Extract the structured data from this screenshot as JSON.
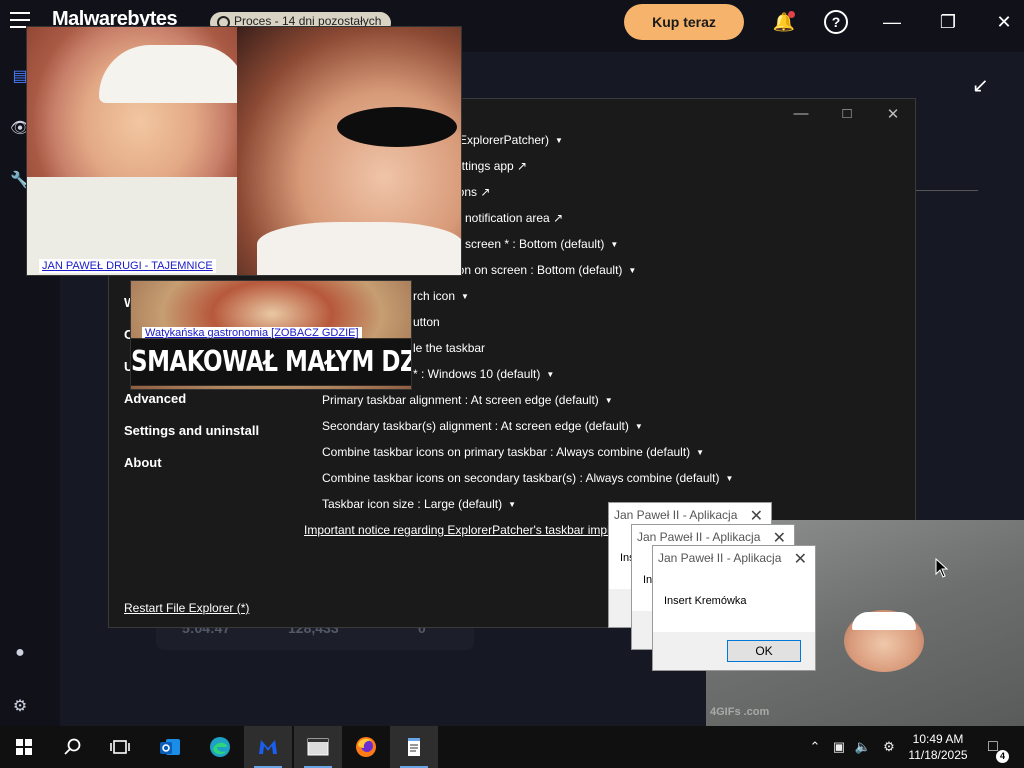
{
  "malwarebytes": {
    "logo": "Malwarebytes",
    "trial_badge": "Proces - 14 dni pozostałych",
    "buy_button": "Kup teraz",
    "stats": [
      "5:04:47",
      "128,433",
      "0"
    ]
  },
  "explorerpatcher": {
    "nav": [
      "W",
      "C",
      "U",
      "Advanced",
      "Settings and uninstall",
      "About"
    ],
    "settings": [
      "(ExplorerPatcher)",
      "ettings app ↗",
      "ions ↗",
      "e notification area ↗",
      "n screen * : Bottom (default)",
      "ion on screen : Bottom (default)",
      "rch icon",
      "utton",
      "le the taskbar",
      "* : Windows 10 (default)",
      "Primary taskbar alignment : At screen edge (default)",
      "Secondary taskbar(s) alignment : At screen edge (default)",
      "Combine taskbar icons on primary taskbar : Always combine (default)",
      "Combine taskbar icons on secondary taskbar(s) : Always combine (default)",
      "Taskbar icon size : Large (default)"
    ],
    "notice_link": "Important notice regarding ExplorerPatcher's taskbar impl",
    "restart_link": "Restart File Explorer (*)"
  },
  "popups": {
    "ad1_caption": "JAN PAWEŁ DRUGI - TAJEMNICE",
    "ad2_link": "Watykańska gastronomia [ZOBACZ GDZIE]",
    "ad2_meme": "SMAKOWAŁ MAŁYM DZIECIOM",
    "gif_watermark": "4GIFs .com"
  },
  "alerts": [
    {
      "title": "Jan Paweł II - Aplikacja",
      "message": "Ins"
    },
    {
      "title": "Jan Paweł II - Aplikacja",
      "message": "Ins"
    },
    {
      "title": "Jan Paweł II - Aplikacja",
      "message": "Insert Kremówka",
      "ok_label": "OK"
    }
  ],
  "taskbar": {
    "apps": [
      "start-icon",
      "search-icon",
      "task-view-icon",
      "outlook-icon",
      "edge-icon",
      "malwarebytes-icon",
      "window-app-icon",
      "firefox-icon",
      "notepad-icon"
    ],
    "time": "10:49 AM",
    "date": "11/18/2025",
    "notification_count": "4"
  },
  "colors": {
    "accent_orange": "#f6b36b",
    "link_blue": "#1a1ac8",
    "taskbar_highlight": "#6aa6e6"
  }
}
